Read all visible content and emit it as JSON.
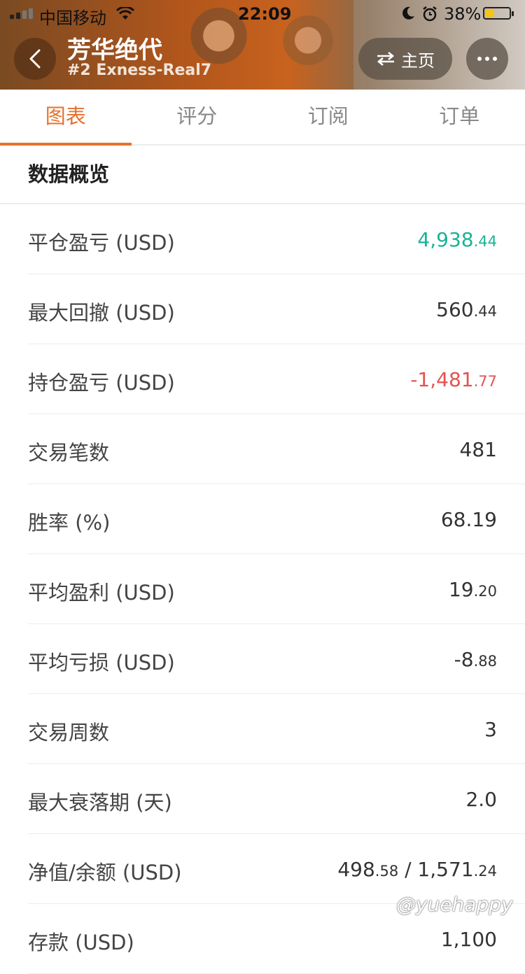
{
  "status_bar": {
    "carrier": "中国移动",
    "time": "22:09",
    "battery_pct": "38%",
    "battery_level": 0.38,
    "icons": [
      "signal-icon",
      "wifi-icon",
      "moon-icon",
      "alarm-icon",
      "battery-icon"
    ]
  },
  "header": {
    "title": "芳华绝代",
    "subtitle": "#2 Exness-Real7",
    "home_label": "主页"
  },
  "tabs": [
    {
      "label": "图表",
      "active": true
    },
    {
      "label": "评分",
      "active": false
    },
    {
      "label": "订阅",
      "active": false
    },
    {
      "label": "订单",
      "active": false
    }
  ],
  "section": {
    "title": "数据概览"
  },
  "rows": [
    {
      "label": "平仓盈亏 (USD)",
      "int": "4,938",
      "frac": ".44",
      "tone": "pos"
    },
    {
      "label": "最大回撤 (USD)",
      "int": "560",
      "frac": ".44",
      "tone": ""
    },
    {
      "label": "持仓盈亏 (USD)",
      "int": "-1,481",
      "frac": ".77",
      "tone": "neg"
    },
    {
      "label": "交易笔数",
      "int": "481",
      "frac": "",
      "tone": ""
    },
    {
      "label": "胜率 (%)",
      "int": "68.19",
      "frac": "",
      "tone": ""
    },
    {
      "label": "平均盈利 (USD)",
      "int": "19",
      "frac": ".20",
      "tone": ""
    },
    {
      "label": "平均亏损 (USD)",
      "int": "-8",
      "frac": ".88",
      "tone": ""
    },
    {
      "label": "交易周数",
      "int": "3",
      "frac": "",
      "tone": ""
    },
    {
      "label": "最大衰落期 (天)",
      "int": "2.0",
      "frac": "",
      "tone": ""
    },
    {
      "label": "净值/余额 (USD)",
      "int": "498",
      "frac": ".58",
      "int2": " / 1,571",
      "frac2": ".24",
      "tone": ""
    },
    {
      "label": "存款 (USD)",
      "int": "1,100",
      "frac": "",
      "tone": ""
    }
  ],
  "colors": {
    "accent": "#e8702a",
    "positive": "#1ab394",
    "negative": "#e4524f"
  },
  "watermark": "@yuehappy"
}
